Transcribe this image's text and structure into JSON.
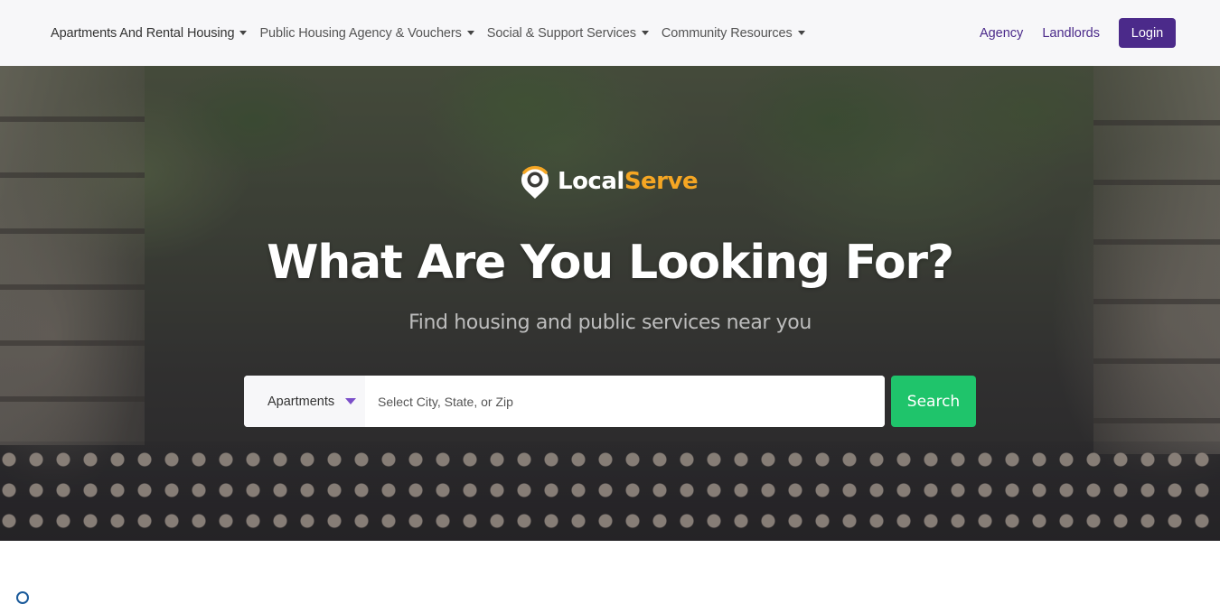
{
  "navbar": {
    "menus": [
      {
        "label": "Apartments And Rental Housing"
      },
      {
        "label": "Public Housing Agency & Vouchers"
      },
      {
        "label": "Social & Support Services"
      },
      {
        "label": "Community Resources"
      }
    ],
    "links": {
      "agency": "Agency",
      "landlords": "Landlords"
    },
    "login_label": "Login"
  },
  "hero": {
    "logo": {
      "part1": "Local",
      "part2": "Serve"
    },
    "title": "What Are You Looking For?",
    "subtitle": "Find housing and public services near you",
    "search": {
      "type_selected": "Apartments",
      "location_placeholder": "Select City, State, or Zip",
      "location_value": "",
      "button_label": "Search"
    }
  },
  "colors": {
    "brand_purple": "#4b2a8a",
    "accent_orange": "#f5a623",
    "search_green": "#1fc46b",
    "navbar_bg": "#f7f7f9"
  }
}
